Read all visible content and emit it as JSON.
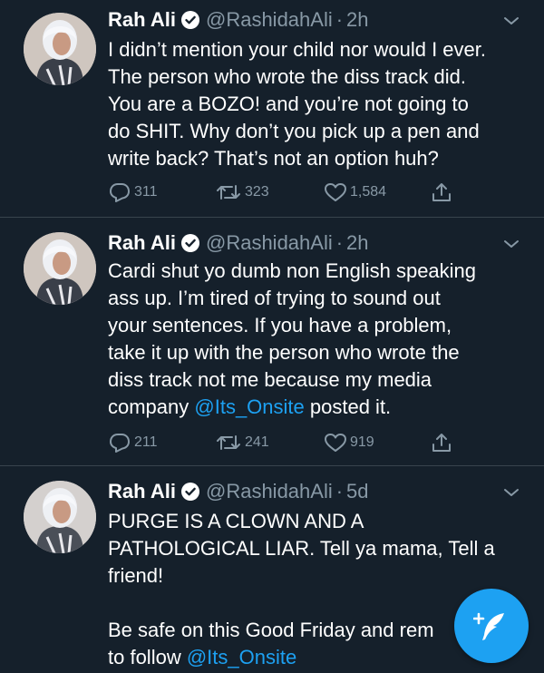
{
  "colors": {
    "background": "#15202b",
    "divider": "#38444d",
    "secondary_text": "#8899a6",
    "accent": "#1da1f2"
  },
  "tweets": [
    {
      "name": "Rah Ali",
      "handle": "@RashidahAli",
      "separator": "·",
      "time": "2h",
      "lines": [
        "I didn’t mention your child nor would I ever.",
        "The person who wrote the diss track did.",
        "You are a BOZO! and you’re not going to",
        "do SHIT. Why don’t you pick up a pen and",
        "write back? That’s not an option huh?"
      ],
      "replies": "311",
      "retweets": "323",
      "likes": "1,584",
      "icons": [
        "verified-badge-icon",
        "caret-down-icon",
        "reply-icon",
        "retweet-icon",
        "like-icon",
        "share-icon"
      ]
    },
    {
      "name": "Rah Ali",
      "handle": "@RashidahAli",
      "separator": "·",
      "time": "2h",
      "lines": [
        "Cardi shut yo dumb non English speaking",
        "ass up. I’m tired of trying to sound out",
        "your sentences. If you have a problem,",
        "take it up with the person who wrote the",
        "diss track not me because my media"
      ],
      "last_line_prefix": "company ",
      "mention": "@Its_Onsite",
      "last_line_suffix": " posted it.",
      "replies": "211",
      "retweets": "241",
      "likes": "919"
    },
    {
      "name": "Rah Ali",
      "handle": "@RashidahAli",
      "separator": "·",
      "time": "5d",
      "lines": [
        "PURGE IS A CLOWN AND A",
        "PATHOLOGICAL LIAR. Tell ya mama, Tell a",
        "friend!",
        "",
        "Be safe on this Good Friday and rem"
      ],
      "last_line_prefix": "to follow ",
      "mention": "@Its_Onsite"
    }
  ],
  "compose_button": {
    "icon": "compose-tweet-icon"
  }
}
